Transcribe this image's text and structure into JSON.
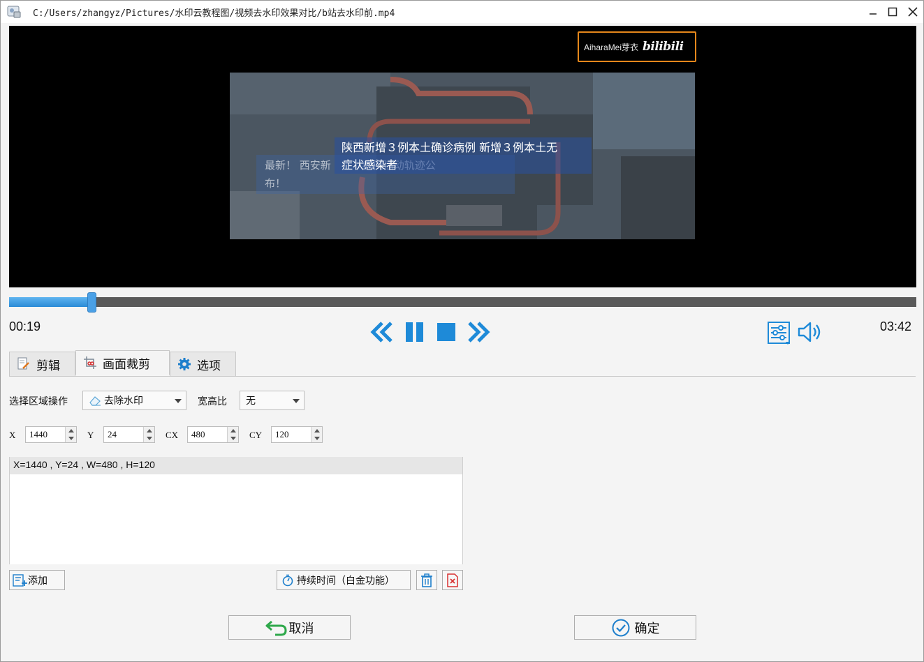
{
  "window": {
    "title": "C:/Users/zhangyz/Pictures/水印云教程图/视频去水印效果对比/b站去水印前.mp4"
  },
  "video": {
    "watermark_text": "AiharaMei芽衣",
    "watermark_logo": "bilibili",
    "subtitle_main_line1": "陕西新增３例本土确诊病例 新增３例本土无",
    "subtitle_main_line2": "症状感染者",
    "subtitle_old_line1": "最新！ 西安新　　　病例活动轨迹公",
    "subtitle_old_line2": "布！"
  },
  "playback": {
    "current_time": "00:19",
    "total_time": "03:42",
    "progress_fraction": 0.091
  },
  "tabs": [
    {
      "label": "剪辑",
      "icon": "edit-icon"
    },
    {
      "label": "画面裁剪",
      "icon": "crop-icon"
    },
    {
      "label": "选项",
      "icon": "gear-icon"
    }
  ],
  "form": {
    "region_op_label": "选择区域操作",
    "region_op_value": "去除水印",
    "aspect_label": "宽高比",
    "aspect_value": "无",
    "x_label": "X",
    "x_value": "1440",
    "y_label": "Y",
    "y_value": "24",
    "cx_label": "CX",
    "cx_value": "480",
    "cy_label": "CY",
    "cy_value": "120"
  },
  "regions": [
    "X=1440 , Y=24 , W=480 , H=120"
  ],
  "buttons": {
    "add": "添加",
    "duration": "持续时间（白金功能）",
    "cancel": "取消",
    "ok": "确定"
  },
  "colors": {
    "accent": "#2a8ad6",
    "watermark_box": "#e5871b"
  }
}
